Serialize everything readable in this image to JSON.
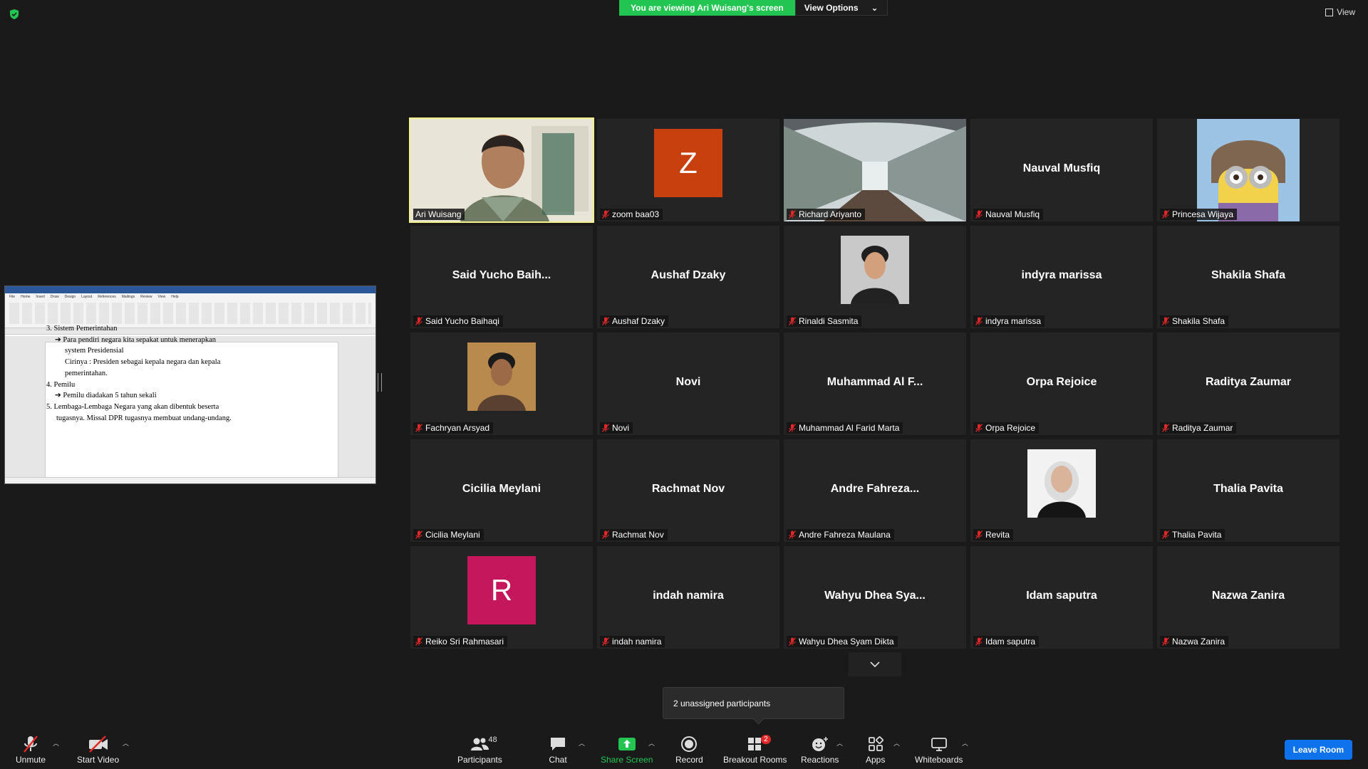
{
  "banner": {
    "viewing_text": "You are viewing Ari Wuisang's screen",
    "view_options": "View Options"
  },
  "top_right_view": "View",
  "shared_doc": {
    "lines": [
      "3.  Sistem Pemerintahan",
      "➔ Para pendiri negara kita sepakat untuk menerapkan",
      "system Presidensial",
      "Cirinya : Presiden sebagai kepala negara dan kepala",
      "pemerintahan.",
      "4.  Pemilu",
      "➔ Pemilu diadakan 5 tahun sekali",
      "5.  Lembaga-Lembaga Negara yang akan dibentuk beserta",
      "tugasnya. Missal DPR tugasnya membuat undang-undang."
    ],
    "ribbon_tabs": [
      "File",
      "Home",
      "Insert",
      "Draw",
      "Design",
      "Layout",
      "References",
      "Mailings",
      "Review",
      "View",
      "Help"
    ]
  },
  "participants": [
    {
      "name": "Ari Wuisang",
      "type": "video",
      "muted": false
    },
    {
      "name": "zoom baa03",
      "type": "letter",
      "letter": "Z",
      "color": "#c9400f",
      "muted": true
    },
    {
      "name": "Richard Ariyanto",
      "type": "full-photo",
      "muted": true
    },
    {
      "name": "Nauval Musfiq",
      "display": "Nauval Musfiq",
      "type": "name",
      "muted": true
    },
    {
      "name": "Princesa Wijaya",
      "type": "mid-photo",
      "muted": true
    },
    {
      "name": "Said Yucho Baihaqi",
      "display": "Said Yucho Baih...",
      "type": "name",
      "muted": true
    },
    {
      "name": "Aushaf Dzaky",
      "display": "Aushaf Dzaky",
      "type": "name",
      "muted": true
    },
    {
      "name": "Rinaldi Sasmita",
      "type": "photo",
      "muted": true
    },
    {
      "name": "indyra marissa",
      "display": "indyra marissa",
      "type": "name",
      "muted": true
    },
    {
      "name": "Shakila Shafa",
      "display": "Shakila Shafa",
      "type": "name",
      "muted": true
    },
    {
      "name": "Fachryan Arsyad",
      "type": "photo",
      "muted": true
    },
    {
      "name": "Novi",
      "display": "Novi",
      "type": "name",
      "muted": true
    },
    {
      "name": "Muhammad Al Farid Marta",
      "display": "Muhammad Al F...",
      "type": "name",
      "muted": true
    },
    {
      "name": "Orpa Rejoice",
      "display": "Orpa Rejoice",
      "type": "name",
      "muted": true
    },
    {
      "name": "Raditya Zaumar",
      "display": "Raditya Zaumar",
      "type": "name",
      "muted": true
    },
    {
      "name": "Cicilia Meylani",
      "display": "Cicilia Meylani",
      "type": "name",
      "muted": true
    },
    {
      "name": "Rachmat Nov",
      "display": "Rachmat Nov",
      "type": "name",
      "muted": true
    },
    {
      "name": "Andre Fahreza Maulana",
      "display": "Andre Fahreza...",
      "type": "name",
      "muted": true
    },
    {
      "name": "Revita",
      "type": "photo",
      "muted": true
    },
    {
      "name": "Thalia Pavita",
      "display": "Thalia Pavita",
      "type": "name",
      "muted": true
    },
    {
      "name": "Reiko Sri Rahmasari",
      "type": "letter",
      "letter": "R",
      "color": "#c4175c",
      "muted": true
    },
    {
      "name": "indah namira",
      "display": "indah namira",
      "type": "name",
      "muted": true
    },
    {
      "name": "Wahyu Dhea Syam Dikta",
      "display": "Wahyu Dhea Sya...",
      "type": "name",
      "muted": true
    },
    {
      "name": "Idam saputra",
      "display": "Idam saputra",
      "type": "name",
      "muted": true
    },
    {
      "name": "Nazwa Zanira",
      "display": "Nazwa Zanira",
      "type": "name",
      "muted": true
    }
  ],
  "tooltip": "2 unassigned participants",
  "toolbar": {
    "unmute": "Unmute",
    "start_video": "Start Video",
    "participants": "Participants",
    "participants_count": "48",
    "chat": "Chat",
    "share_screen": "Share Screen",
    "record": "Record",
    "breakout_rooms": "Breakout Rooms",
    "breakout_badge": "2",
    "reactions": "Reactions",
    "apps": "Apps",
    "whiteboards": "Whiteboards",
    "leave": "Leave Room"
  },
  "colors": {
    "accent_green": "#23c552",
    "leave_blue": "#0e72ed",
    "active_outline": "#f2f08a",
    "mute_red": "#e02828"
  }
}
